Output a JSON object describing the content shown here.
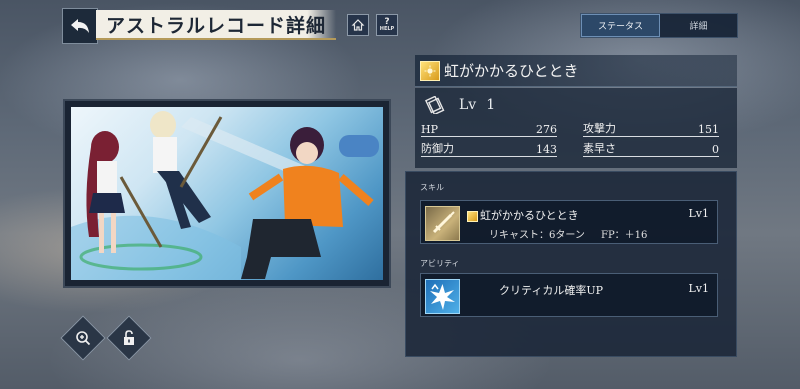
{
  "header": {
    "title": "アストラルレコード詳細",
    "help_label": "HELP"
  },
  "tabs": [
    {
      "label": "ステータス",
      "active": true
    },
    {
      "label": "詳細",
      "active": false
    }
  ],
  "record": {
    "name": "虹がかかるひととき",
    "level_prefix": "Lv",
    "level": "1",
    "stats": [
      {
        "label": "HP",
        "value": "276"
      },
      {
        "label": "攻撃力",
        "value": "151"
      },
      {
        "label": "防御力",
        "value": "143"
      },
      {
        "label": "素早さ",
        "value": "0"
      }
    ]
  },
  "skills": {
    "section_label": "スキル",
    "items": [
      {
        "name": "虹がかかるひととき",
        "level": "Lv1",
        "recast": "リキャスト：6ターン",
        "fp": "FP：＋16",
        "icon": "sword-icon"
      }
    ]
  },
  "abilities": {
    "section_label": "アビリティ",
    "items": [
      {
        "name": "クリティカル確率UP",
        "level": "Lv1",
        "icon": "burst-icon"
      }
    ]
  },
  "colors": {
    "panel": "#1b283a",
    "accent_gold": "#b49a5a",
    "tab_active": "#2c4868"
  }
}
